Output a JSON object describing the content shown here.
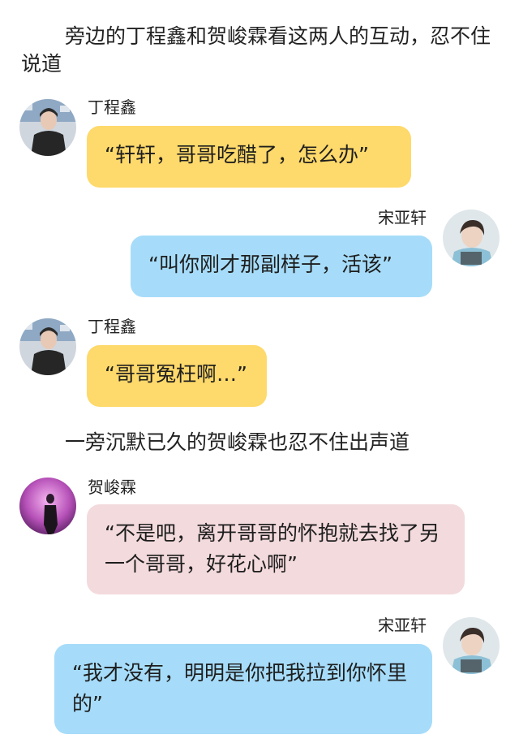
{
  "narration": {
    "line1": "旁边的丁程鑫和贺峻霖看这两人的互动，忍不住说道",
    "line2": "一旁沉默已久的贺峻霖也忍不住出声道"
  },
  "messages": [
    {
      "sender": "丁程鑫",
      "text": "“轩轩，哥哥吃醋了，怎么办”",
      "side": "left",
      "color": "#fed96b"
    },
    {
      "sender": "宋亚轩",
      "text": "“叫你刚才那副样子，活该”",
      "side": "right",
      "color": "#a6dcf9"
    },
    {
      "sender": "丁程鑫",
      "text": "“哥哥冤枉啊…”",
      "side": "left",
      "color": "#fed96b"
    },
    {
      "sender": "贺峻霖",
      "text": "“不是吧，离开哥哥的怀抱就去找了另一个哥哥，好花心啊”",
      "side": "left",
      "color": "#f3dadd"
    },
    {
      "sender": "宋亚轩",
      "text": "“我才没有，明明是你把我拉到你怀里的”",
      "side": "right",
      "color": "#a6dcf9"
    }
  ]
}
